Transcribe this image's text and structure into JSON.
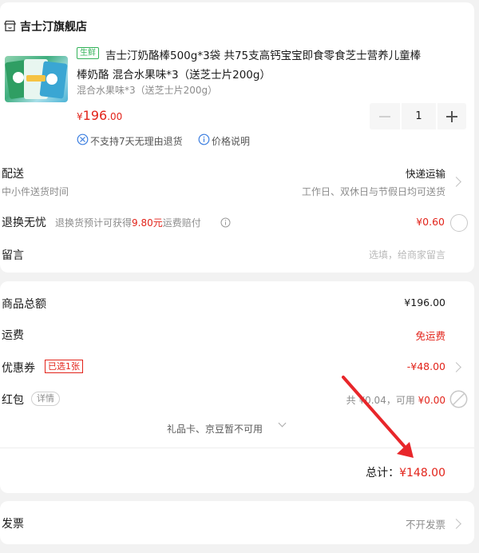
{
  "store": {
    "name": "吉士汀旗舰店",
    "icon": "store-icon"
  },
  "product": {
    "tag": "生鲜",
    "title_line1": "吉士汀奶酪棒500g*3袋 共75支高钙宝宝即食零食芝士营养儿童棒",
    "title_line2": "棒奶酪 混合水果味*3（送芝士片200g）",
    "spec": "混合水果味*3（送芝士片200g）",
    "price_symbol": "¥",
    "price_int": "196",
    "price_dec": ".00",
    "quantity": "1",
    "notice_no_return": "不支持7天无理由退货",
    "notice_price": "价格说明"
  },
  "delivery": {
    "label": "配送",
    "sub": "中小件送货时间",
    "method": "快递运输",
    "time": "工作日、双休日与节假日均可送货"
  },
  "return_insurance": {
    "label": "退换无忧",
    "desc_prefix": "退换货预计可获得",
    "desc_amount": "9.80元",
    "desc_suffix": "运费赔付",
    "price": "¥0.60"
  },
  "message": {
    "label": "留言",
    "placeholder": "选填，给商家留言"
  },
  "summary": {
    "goods_total_label": "商品总额",
    "goods_total": "¥196.00",
    "shipping_label": "运费",
    "shipping": "免运费",
    "coupon_label": "优惠券",
    "coupon_badge": "已选1张",
    "coupon_value": "-¥48.00",
    "redpacket_label": "红包",
    "redpacket_detail": "详情",
    "redpacket_info_prefix": "共 ¥0.04，可用 ",
    "redpacket_info_amount": "¥0.00",
    "gift_card_note": "礼品卡、京豆暂不可用",
    "total_label": "总计：",
    "total_value": "¥148.00"
  },
  "invoice": {
    "label": "发票",
    "value": "不开发票"
  },
  "colors": {
    "accent": "#e2231a",
    "tag_green": "#34b35a",
    "annotation_arrow": "#e8262a"
  }
}
